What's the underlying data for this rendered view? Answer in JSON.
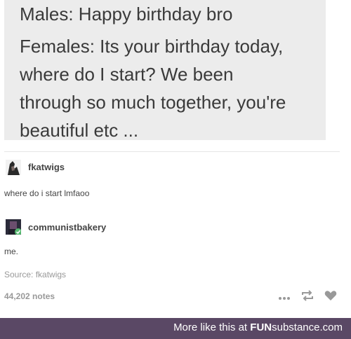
{
  "quote": {
    "lines": [
      "Males: Happy birthday bro",
      "Females: Its your birthday today,",
      "where do I start? We been",
      "through so much together, you're",
      "beautiful etc ..."
    ]
  },
  "posts": [
    {
      "username": "fkatwigs",
      "text": "where do i start lmfaoo"
    },
    {
      "username": "communistbakery",
      "text": "me."
    }
  ],
  "source": "Source: fkatwigs",
  "notes": "44,202 notes",
  "icons": {
    "more": "more-dots-icon",
    "reblog": "reblog-icon",
    "like": "heart-icon"
  },
  "footer": {
    "prefix": "More like this at ",
    "brand_bold": "FUN",
    "brand_rest": "substance.com"
  },
  "colors": {
    "footer_bg": "#5a4865",
    "quote_bg": "#ececec"
  }
}
